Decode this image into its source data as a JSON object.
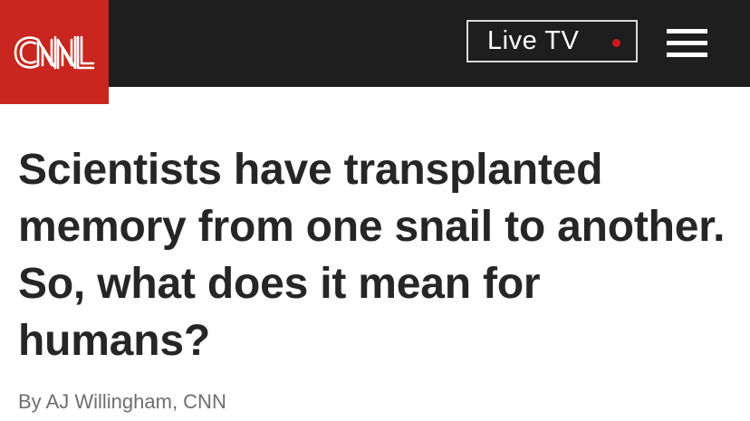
{
  "header": {
    "logo_text": "CNN",
    "live_tv_label": "Live TV",
    "live_indicator_color": "#cc1a1a",
    "menu_icon": "hamburger-menu-icon",
    "brand_color": "#c8261e",
    "bar_color": "#1e1e1e"
  },
  "article": {
    "headline": "Scientists have transplanted memory from one snail to another. So, what does it mean for humans?",
    "byline": "By AJ Willingham, CNN"
  }
}
